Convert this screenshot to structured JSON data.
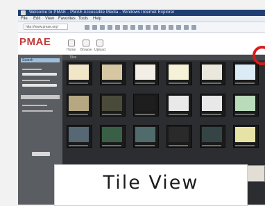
{
  "window": {
    "title": "Welcome to PMAE - PMAE Accessible Media - Windows Internet Explorer"
  },
  "menu": [
    "File",
    "Edit",
    "View",
    "Favorites",
    "Tools",
    "Help"
  ],
  "address": {
    "url": "http://www.pmae.org/"
  },
  "header": {
    "logo": "PMAE",
    "nav": [
      "Home",
      "Browse",
      "Upload"
    ]
  },
  "sidebar": {
    "title": "Search"
  },
  "content": {
    "head_label": "Tiles",
    "tile_colors": [
      "#f2e6c9",
      "#d6c7a2",
      "#f3efe6",
      "#f6f2d8",
      "#eae8dd",
      "#dcecf7",
      "#b7a883",
      "#4a4a3a",
      "#1e1e1e",
      "#e9e9e9",
      "#e8e8e8",
      "#b9dbb9",
      "#556873",
      "#3a5f47",
      "#4f6b6b",
      "#2a2a2a",
      "#354545",
      "#e7e3a6"
    ]
  },
  "overlay": {
    "label": "Tile View"
  },
  "colors": {
    "accent": "#d51c1c",
    "titlebar": "#1f3f74",
    "logo": "#c43c3c",
    "sidebar": "#5a5d62",
    "content_bg": "#2c2d30"
  }
}
